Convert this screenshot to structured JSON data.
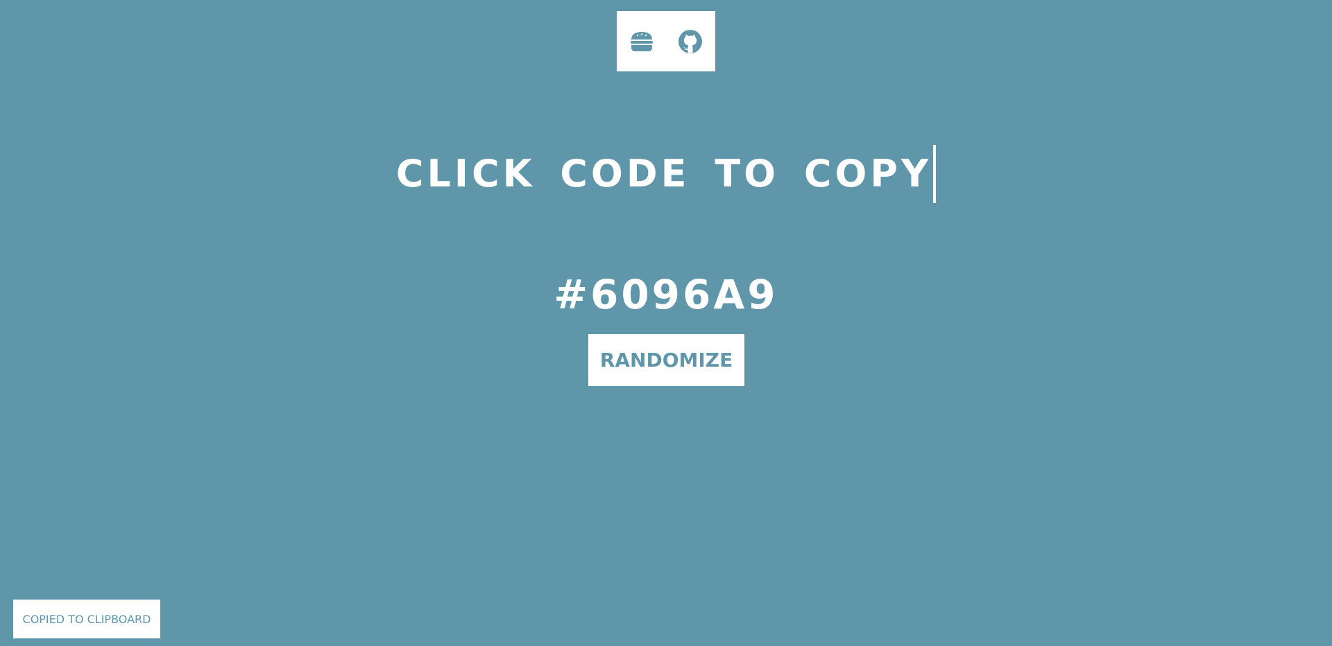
{
  "colors": {
    "background": "#6096a9",
    "foreground": "#ffffff",
    "accent": "#6096a9"
  },
  "topbar": {
    "menu_icon": "burger-icon",
    "github_icon": "github-icon"
  },
  "headline": "CLICK CODE TO COPY",
  "color_code": "#6096A9",
  "randomize_label": "RANDOMIZE",
  "toast": "COPIED TO CLIPBOARD"
}
